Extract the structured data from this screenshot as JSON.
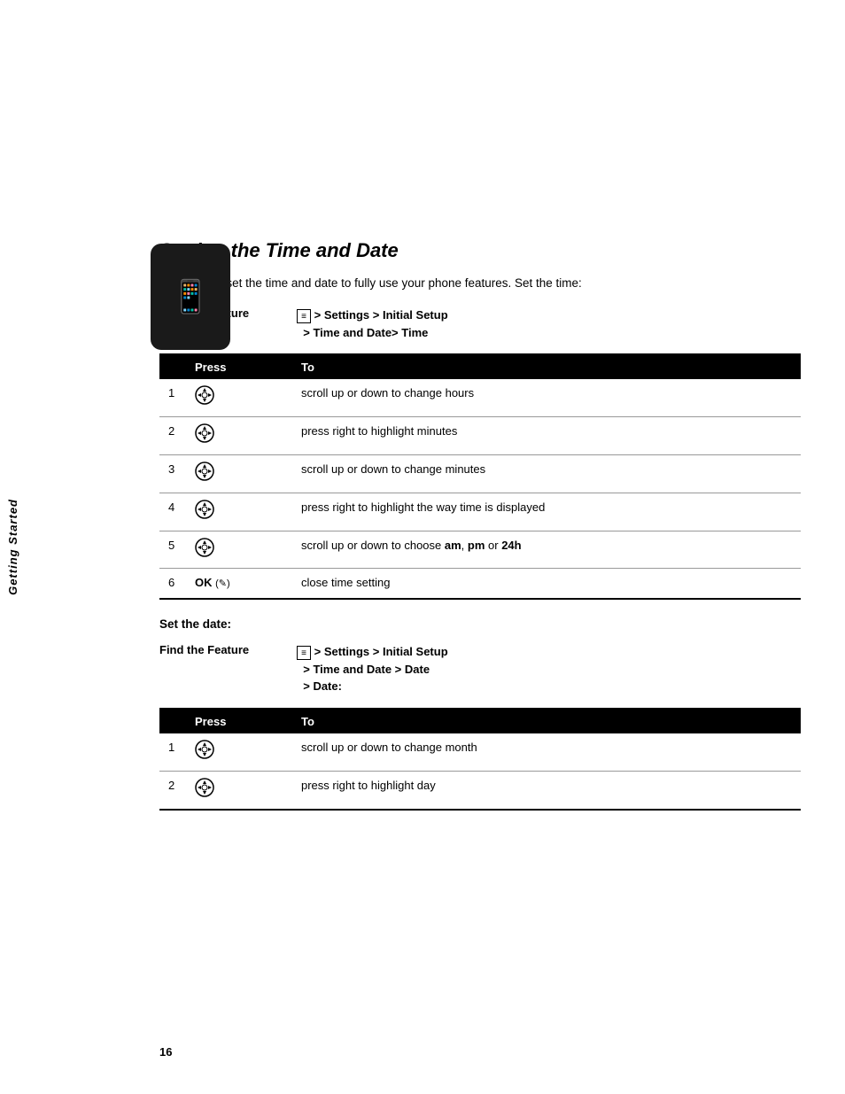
{
  "sidebar": {
    "label": "Getting Started"
  },
  "page": {
    "number": "16"
  },
  "section": {
    "title": "Setting the Time and Date",
    "intro": "You need to set the time and date to fully use your phone features. Set the time:"
  },
  "time_section": {
    "find_feature_label": "Find the Feature",
    "find_feature_path": "> Settings > Initial Setup > Time and Date> Time",
    "table_headers": [
      "Press",
      "To"
    ],
    "rows": [
      {
        "num": "1",
        "press_icon": "nav",
        "action": "scroll up or down to change hours"
      },
      {
        "num": "2",
        "press_icon": "nav",
        "action": "press right to highlight minutes"
      },
      {
        "num": "3",
        "press_icon": "nav",
        "action": "scroll up or down to change minutes"
      },
      {
        "num": "4",
        "press_icon": "nav",
        "action": "press right to highlight the way time is displayed"
      },
      {
        "num": "5",
        "press_icon": "nav",
        "action_prefix": "scroll up or down to choose ",
        "action_bold": "am, pm",
        "action_middle": " or ",
        "action_bold2": "24h",
        "action": "scroll up or down to choose am, pm or 24h"
      },
      {
        "num": "6",
        "press_text": "OK",
        "press_icon_key": "ok",
        "action": "close time setting"
      }
    ]
  },
  "date_section": {
    "header": "Set the date:",
    "find_feature_label": "Find the Feature",
    "find_feature_path": "> Settings > Initial Setup > Time and Date > Date > Date:",
    "table_headers": [
      "Press",
      "To"
    ],
    "rows": [
      {
        "num": "1",
        "press_icon": "nav",
        "action": "scroll up or down to change month"
      },
      {
        "num": "2",
        "press_icon": "nav",
        "action": "press right to highlight day"
      }
    ]
  }
}
